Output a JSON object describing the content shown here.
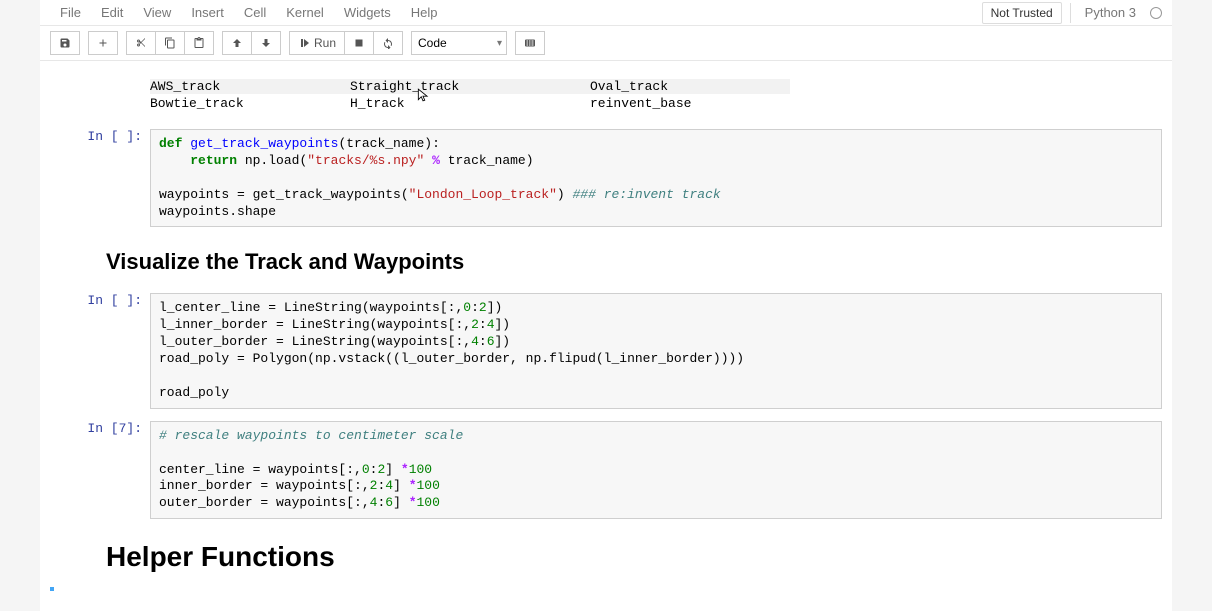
{
  "menu": {
    "file": "File",
    "edit": "Edit",
    "view": "View",
    "insert": "Insert",
    "cell": "Cell",
    "kernel": "Kernel",
    "widgets": "Widgets",
    "help": "Help"
  },
  "trust": "Not Trusted",
  "kernel_name": "Python 3",
  "toolbar": {
    "run_label": "Run",
    "celltype": "Code"
  },
  "output_tracks": {
    "row1": {
      "c1": "AWS_track",
      "c2": "Straight_track",
      "c3": "Oval_track"
    },
    "row2": {
      "c1": "Bowtie_track",
      "c2": "H_track",
      "c3": "reinvent_base"
    }
  },
  "cell1": {
    "prompt": "In [ ]:",
    "line1a": "def ",
    "line1b": "get_track_waypoints",
    "line1c": "(track_name):",
    "line2a": "    ",
    "line2b": "return",
    "line2c": " np.load(",
    "line2d": "\"tracks/%s.npy\"",
    "line2e": " ",
    "line2f": "%",
    "line2g": " track_name)",
    "line3": "",
    "line4a": "waypoints = get_track_waypoints(",
    "line4b": "\"London_Loop_track\"",
    "line4c": ") ",
    "line4d": "### re:invent track",
    "line5": "waypoints.shape"
  },
  "heading_viz": "Visualize the Track and Waypoints",
  "cell2": {
    "prompt": "In [ ]:",
    "l1a": "l_center_line = LineString(waypoints[:,",
    "l1b": "0",
    "l1c": ":",
    "l1d": "2",
    "l1e": "])",
    "l2a": "l_inner_border = LineString(waypoints[:,",
    "l2b": "2",
    "l2c": ":",
    "l2d": "4",
    "l2e": "])",
    "l3a": "l_outer_border = LineString(waypoints[:,",
    "l3b": "4",
    "l3c": ":",
    "l3d": "6",
    "l3e": "])",
    "l4": "road_poly = Polygon(np.vstack((l_outer_border, np.flipud(l_inner_border))))",
    "l5": "",
    "l6": "road_poly"
  },
  "cell3": {
    "prompt": "In [7]:",
    "l1": "# rescale waypoints to centimeter scale",
    "l2": "",
    "l3a": "center_line = waypoints[:,",
    "l3b": "0",
    "l3c": ":",
    "l3d": "2",
    "l3e": "] ",
    "l3f": "*",
    "l3g": "100",
    "l4a": "inner_border = waypoints[:,",
    "l4b": "2",
    "l4c": ":",
    "l4d": "4",
    "l4e": "] ",
    "l4f": "*",
    "l4g": "100",
    "l5a": "outer_border = waypoints[:,",
    "l5b": "4",
    "l5c": ":",
    "l5d": "6",
    "l5e": "] ",
    "l5f": "*",
    "l5g": "100"
  },
  "heading_helper": "Helper Functions"
}
